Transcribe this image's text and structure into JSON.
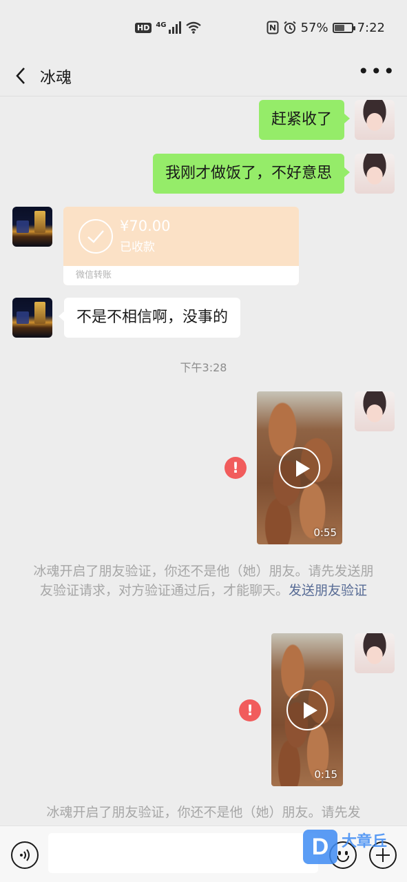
{
  "status_bar": {
    "network_hd": "HD",
    "network_gen": "4G",
    "battery_percent": "57%",
    "battery_level": 0.57,
    "time": "7:22",
    "icons": [
      "hd-icon",
      "signal-icon",
      "wifi-icon",
      "nfc-icon",
      "alarm-icon",
      "battery-icon"
    ]
  },
  "header": {
    "title": "冰魂",
    "more_label": "•••"
  },
  "messages": {
    "m1": {
      "sender": "self",
      "text": "赶紧收了"
    },
    "m2": {
      "sender": "self",
      "text": "我刚才做饭了，不好意思"
    },
    "m3": {
      "sender": "other",
      "type": "transfer",
      "amount": "¥70.00",
      "status": "已收款",
      "footer": "微信转账"
    },
    "m4": {
      "sender": "other",
      "text": "不是不相信啊，没事的"
    },
    "timestamp": "下午3:28",
    "v1": {
      "sender": "self",
      "type": "video",
      "duration": "0:55",
      "send_failed": true,
      "fail_mark": "!"
    },
    "note1": {
      "text": "冰魂开启了朋友验证，你还不是他（她）朋友。请先发送朋友验证请求，对方验证通过后，才能聊天。",
      "link": "发送朋友验证"
    },
    "v2": {
      "sender": "self",
      "type": "video",
      "duration": "0:15",
      "send_failed": true,
      "fail_mark": "!"
    },
    "note2": {
      "text": "冰魂开启了朋友验证，你还不是他（她）朋友。请先发"
    }
  },
  "input_bar": {
    "placeholder": ""
  },
  "watermark": {
    "logo": "D",
    "text": "大章丘"
  },
  "colors": {
    "self_bubble": "#95ec69",
    "other_bubble": "#ffffff",
    "transfer_bg": "#fbe1c6",
    "fail_red": "#f15c5c",
    "link_blue": "#576b95",
    "background": "#ededed"
  }
}
